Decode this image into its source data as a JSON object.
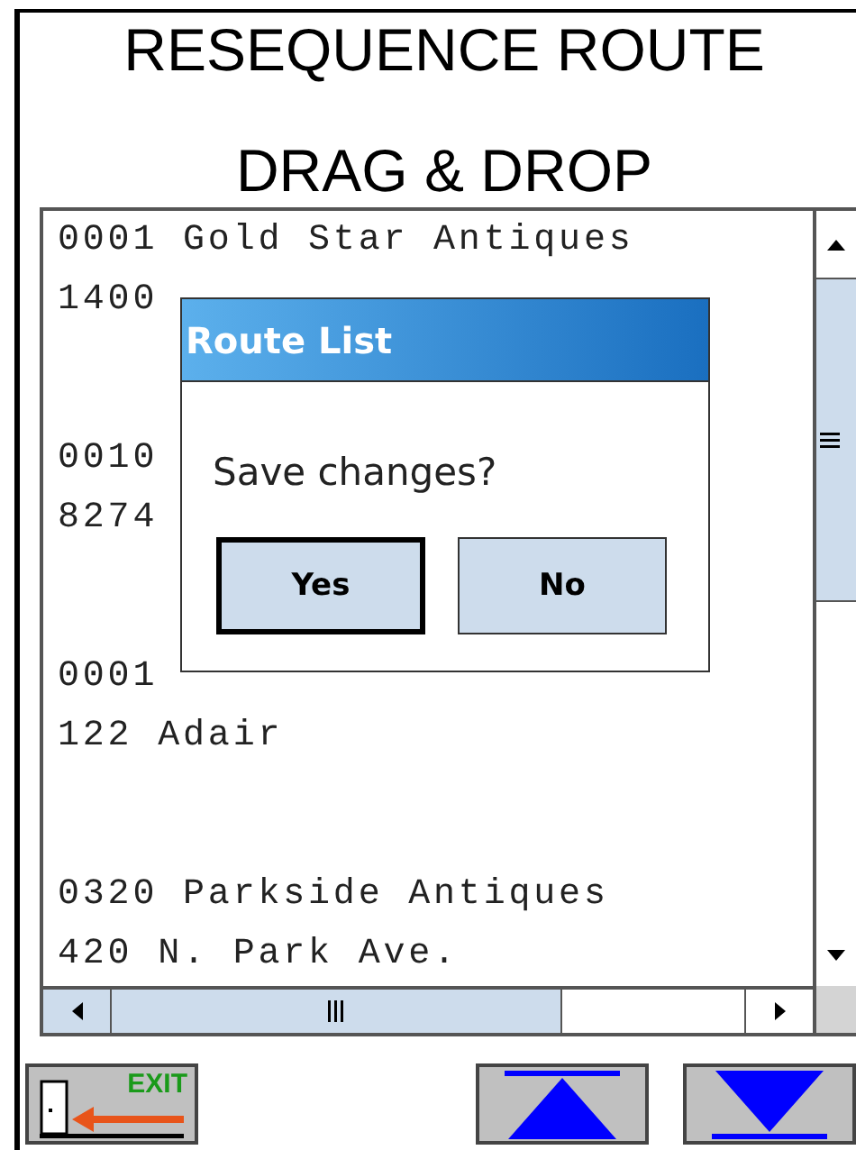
{
  "title_lines": [
    "RESEQUENCE ROUTE",
    "DRAG & DROP"
  ],
  "route_list": {
    "items": [
      {
        "line_1": "0001 Gold Star Antiques",
        "line_2": "1400"
      },
      {
        "line_1": "0010",
        "line_2": "8274"
      },
      {
        "line_1": "0001",
        "line_2": "122 Adair"
      },
      {
        "line_1": "0320 Parkside Antiques",
        "line_2": "420 N. Park Ave."
      }
    ]
  },
  "dialog": {
    "title": "Route List",
    "message": "Save changes?",
    "buttons": [
      {
        "label": "Yes",
        "selected": true
      },
      {
        "label": "No",
        "selected": false
      }
    ]
  },
  "exit_button": {
    "label": "EXIT"
  }
}
